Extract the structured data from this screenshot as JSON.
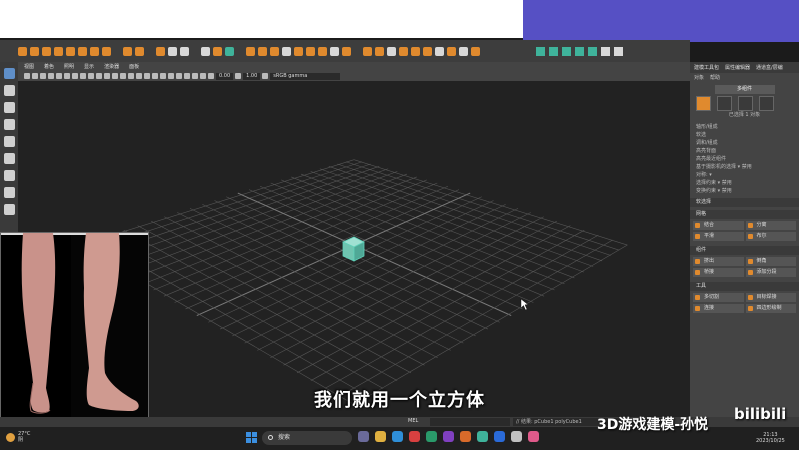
{
  "viewport": {
    "menu": [
      "视图",
      "着色",
      "照明",
      "显示",
      "渲染器",
      "面板"
    ],
    "num1": "0.00",
    "num2": "1.00",
    "color_space": "sRGB gamma"
  },
  "right_panel": {
    "tabs": [
      "建模工具包",
      "属性编辑器",
      "通道盒/层编"
    ],
    "sub_tabs": [
      "对象",
      "帮助"
    ],
    "multi_button": "多组件",
    "selected_info": "已选择 1 对象",
    "options": [
      "轴形/组成",
      "软选",
      "调和/组成"
    ],
    "checkbox_1": "高亮背面",
    "checkbox_2": "高亮最近组件",
    "select_line_1": "基于摄影机的选择 ▾ 禁用",
    "select_line_2": "对称: ▾",
    "select_line_3": "选择约束 ▾ 禁用",
    "select_line_4": "变换约束 ▾ 禁用",
    "soft_select": "软选择",
    "sections": [
      {
        "title": "网格",
        "items": [
          "结合",
          "分离",
          "平滑",
          "布尔"
        ]
      },
      {
        "title": "组件",
        "items": [
          "挤出",
          "倒角",
          "桥接",
          "添加分段"
        ]
      },
      {
        "title": "工具",
        "items": [
          "多切割",
          "目标焊接",
          "连接",
          "四边形绘制"
        ]
      }
    ]
  },
  "status": {
    "mel": "MEL",
    "result": "// 结果: pCube1 polyCube1"
  },
  "subtitle": "我们就用一个立方体",
  "taskbar": {
    "temp": "27°C",
    "weather": "阴",
    "search": "搜索",
    "time": "21:13",
    "date": "2023/10/25"
  },
  "watermark": {
    "text": "3D游戏建模-孙悦",
    "logo": "bilibili"
  },
  "colors": {
    "accent": "#e08a2e",
    "cube": "#4fbfa8",
    "top_accent": "#5650c4"
  }
}
